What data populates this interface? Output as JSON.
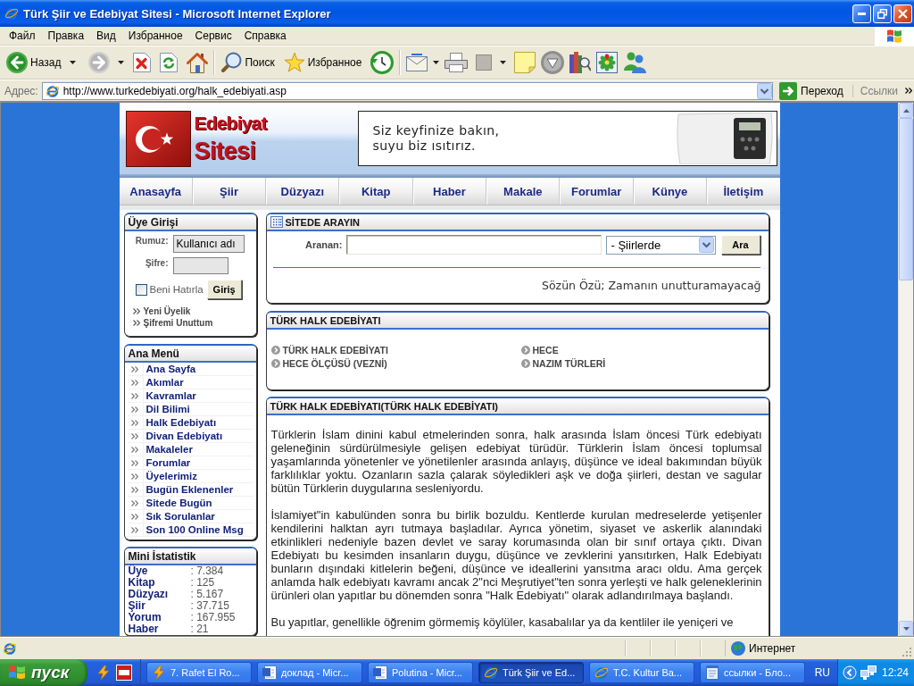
{
  "window": {
    "title": "Türk Şiir ve Edebiyat Sitesi - Microsoft Internet Explorer"
  },
  "menu_bar": [
    "Файл",
    "Правка",
    "Вид",
    "Избранное",
    "Сервис",
    "Справка"
  ],
  "toolbar": {
    "back": {
      "label": "Назад",
      "disabled": false
    },
    "forward": {
      "disabled": true
    },
    "search": {
      "label": "Поиск"
    },
    "favorites": {
      "label": "Избранное"
    }
  },
  "address_bar": {
    "label": "Адрес:",
    "url": "http://www.turkedebiyati.org/halk_edebiyati.asp",
    "go": "Переход",
    "links": "Ссылки"
  },
  "site": {
    "logo": {
      "top": "Edebiyat",
      "bottom": "Sitesi"
    },
    "banner": [
      "Siz keyfinize bakın,",
      "suyu biz ısıtırız."
    ],
    "nav": [
      "Anasayfa",
      "Şiir",
      "Düzyazı",
      "Kitap",
      "Haber",
      "Makale",
      "Forumlar",
      "Künye",
      "İletişim"
    ],
    "login": {
      "title": "Üye Girişi",
      "username_label": "Rumuz:",
      "username_value": "Kullanıcı adı",
      "password_label": "Şifre:",
      "remember": {
        "label": "Beni Hatırla",
        "checked": false
      },
      "submit": "Giriş",
      "links": [
        "Yeni Üyelik",
        "Şifremi Unuttum"
      ]
    },
    "main_menu": {
      "title": "Ana Menü",
      "items": [
        "Ana Sayfa",
        "Akımlar",
        "Kavramlar",
        "Dil Bilimi",
        "Halk Edebiyatı",
        "Divan Edebiyatı",
        "Makaleler",
        "Forumlar",
        "Üyelerimiz",
        "Bugün Eklenenler",
        "Sitede Bugün",
        "Sık Sorulanlar",
        "Son 100 Online Msg"
      ]
    },
    "stats": {
      "title": "Mini İstatistik",
      "rows": [
        {
          "label": "Üye",
          "value": ": 7.384"
        },
        {
          "label": "Kitap",
          "value": ": 125"
        },
        {
          "label": "Düzyazı",
          "value": ": 5.167"
        },
        {
          "label": "Şiir",
          "value": ": 37.715"
        },
        {
          "label": "Yorum",
          "value": ": 167.955"
        },
        {
          "label": "Haber",
          "value": ": 21"
        }
      ]
    },
    "search": {
      "title": "SİTEDE ARAYIN",
      "label": "Aranan:",
      "category": "- Şiirlerde",
      "button": "Ara",
      "ticker": "Sözün Özü; Zamanın unutturamayacağ"
    },
    "topics": {
      "title": "TÜRK HALK EDEBİYATI",
      "links": [
        "TÜRK HALK EDEBİYATI",
        "HECE",
        "HECE ÖLÇÜSÜ (VEZNİ)",
        "NAZIM TÜRLERİ"
      ]
    },
    "article": {
      "title": "TÜRK HALK EDEBİYATI(TÜRK HALK EDEBİYATI)",
      "paragraphs": [
        "Türklerin İslam dinini kabul etmelerinden sonra, halk arasında İslam öncesi Türk edebiyatı geleneğinin sürdürülmesiyle gelişen edebiyat türüdür. Türklerin İslam öncesi toplumsal yaşamlarında yönetenler ve yönetilenler arasında anlayış, düşünce ve ideal bakımından büyük farklılıklar yoktu. Ozanların sazla çalarak söyledikleri aşk ve doğa şiirleri, destan ve sagular bütün Türklerin duygularına sesleniyordu.",
        "İslamiyet\"in kabulünden sonra bu birlik bozuldu. Kentlerde kurulan medreselerde yetişenler kendilerini halktan ayrı tutmaya başladılar. Ayrıca yönetim, siyaset ve askerlik alanındaki etkinlikleri nedeniyle bazen devlet ve saray korumasında olan bir sınıf ortaya çıktı. Divan Edebiyatı bu kesimden insanların duygu, düşünce ve zevklerini yansıtırken, Halk Edebiyatı bunların dışındaki kitlelerin beğeni, düşünce ve ideallerini yansıtma aracı oldu. Ama gerçek anlamda halk edebiyatı kavramı ancak 2\"nci Meşrutiyet\"ten sonra yerleşti ve halk geleneklerinin ürünleri olan yapıtlar bu dönemden sonra \"Halk Edebiyatı\" olarak adlandırılmaya başlandı.",
        "Bu yapıtlar, genellikle öğrenim görmemiş köylüler, kasabalılar ya da kentliler ile yeniçeri ve"
      ]
    }
  },
  "status_bar": {
    "zone": "Интернет"
  },
  "taskbar": {
    "start": "пуск",
    "tasks": [
      {
        "kind": "media",
        "label": "7. Rafet El Ro...",
        "selected": false
      },
      {
        "kind": "word",
        "label": "доклад - Micr...",
        "selected": false
      },
      {
        "kind": "word",
        "label": "Polutina - Micr...",
        "selected": false
      },
      {
        "kind": "browser",
        "label": "Türk Şiir ve Ed...",
        "selected": true
      },
      {
        "kind": "browser",
        "label": "T.C. Kultur Ba...",
        "selected": false
      },
      {
        "kind": "notepad",
        "label": "ссылки - Бло...",
        "selected": false
      }
    ],
    "language": "RU",
    "clock": "12:24"
  }
}
